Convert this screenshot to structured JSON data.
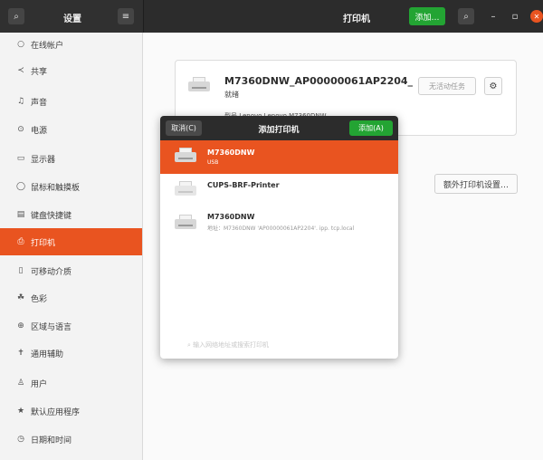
{
  "left_header": {
    "search_icon": "search-icon",
    "title": "设置",
    "menu_icon": "hamburger-menu-icon"
  },
  "right_header": {
    "title": "打印机",
    "add_label": "添加…",
    "search_icon": "search-icon",
    "minimize_symbol": "–",
    "maximize_symbol": "▫",
    "close_symbol": "✕"
  },
  "sidebar": {
    "items": [
      {
        "label": "在线帐户",
        "icon": "○"
      },
      {
        "label": "共享",
        "icon": "≺"
      },
      {
        "label": "声音",
        "icon": "♫"
      },
      {
        "label": "电源",
        "icon": "⊙"
      },
      {
        "label": "显示器",
        "icon": "▭"
      },
      {
        "label": "鼠标和触摸板",
        "icon": "◯"
      },
      {
        "label": "键盘快捷键",
        "icon": "▤"
      },
      {
        "label": "打印机",
        "icon": "⎙"
      },
      {
        "label": "可移动介质",
        "icon": "▯"
      },
      {
        "label": "色彩",
        "icon": "☘"
      },
      {
        "label": "区域与语言",
        "icon": "⊕"
      },
      {
        "label": "通用辅助",
        "icon": "✝"
      },
      {
        "label": "用户",
        "icon": "♙"
      },
      {
        "label": "默认应用程序",
        "icon": "★"
      },
      {
        "label": "日期和时间",
        "icon": "◷"
      }
    ],
    "active_index": 7,
    "accent_color": "#e95420"
  },
  "printer_card": {
    "name": "M7360DNW_AP00000061AP2204_",
    "status": "就绪",
    "no_jobs_label": "无活动任务",
    "model_text": "型号 Lenovo Lenovo M7360DNW"
  },
  "extra_settings_label": "额外打印机设置…",
  "dialog": {
    "cancel_label": "取消(C)",
    "title": "添加打印机",
    "add_label": "添加(A)",
    "items": [
      {
        "name": "M7360DNW",
        "sub": "USB"
      },
      {
        "name": "CUPS-BRF-Printer",
        "sub": ""
      },
      {
        "name": "M7360DNW",
        "sub": "地址：M7360DNW 'AP00000061AP2204'. ipp. tcp.local"
      }
    ],
    "selected_index": 0,
    "search_placeholder": "输入网络地址或搜索打印机"
  },
  "colors": {
    "accent": "#e95420",
    "add_green": "#23a433",
    "header_dark": "#2c2c2c"
  }
}
